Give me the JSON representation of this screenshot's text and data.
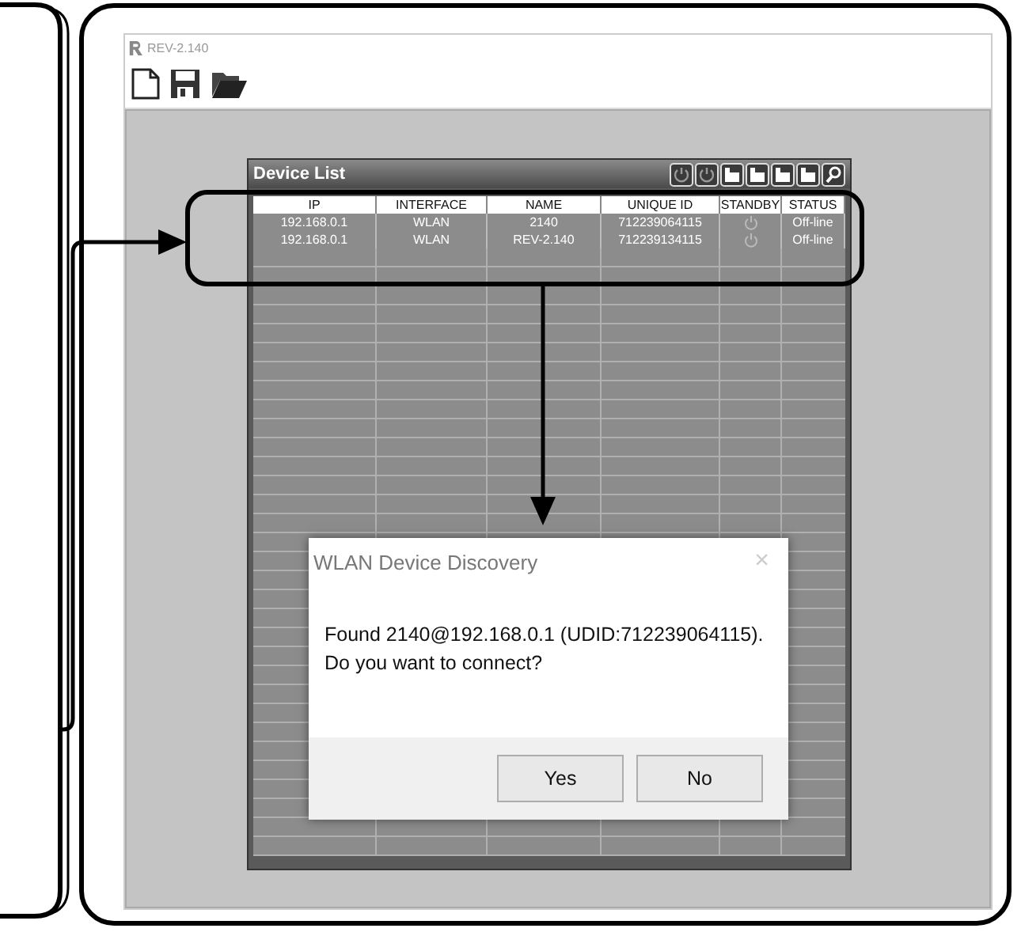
{
  "app": {
    "title": "REV-2.140"
  },
  "device_list": {
    "title": "Device List",
    "columns": [
      "IP",
      "INTERFACE",
      "NAME",
      "UNIQUE ID",
      "STANDBY",
      "STATUS"
    ],
    "rows": [
      {
        "ip": "192.168.0.1",
        "interface": "WLAN",
        "name": "2140",
        "unique_id": "712239064115",
        "status": "Off-line"
      },
      {
        "ip": "192.168.0.1",
        "interface": "WLAN",
        "name": "REV-2.140",
        "unique_id": "712239134115",
        "status": "Off-line"
      }
    ]
  },
  "dialog": {
    "title": "WLAN Device Discovery",
    "close": "×",
    "lines": [
      "Found 2140@192.168.0.1 (UDID:712239064115).",
      "Do you want to connect?"
    ],
    "buttons": [
      "Yes",
      "No"
    ]
  }
}
